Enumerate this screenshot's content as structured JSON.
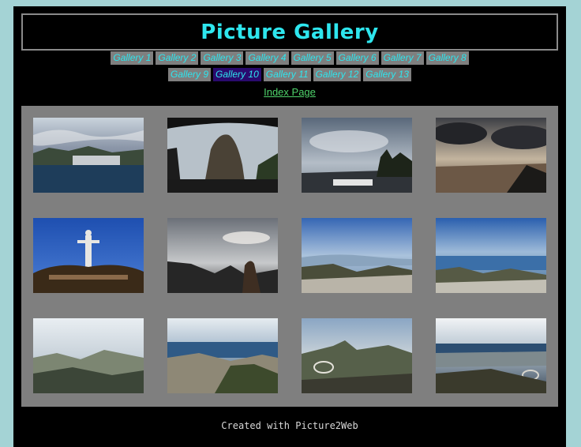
{
  "header": {
    "title": "Picture Gallery"
  },
  "nav": {
    "row1": [
      "Gallery 1",
      "Gallery 2",
      "Gallery 3",
      "Gallery 4",
      "Gallery 5",
      "Gallery 6",
      "Gallery 7",
      "Gallery 8"
    ],
    "row2": [
      "Gallery 9",
      "Gallery 10",
      "Gallery 11",
      "Gallery 12",
      "Gallery 13"
    ],
    "active": "Gallery 10",
    "index_label": "Index Page"
  },
  "footer": {
    "credit": "Created with Picture2Web"
  },
  "colors": {
    "page_bg": "#a4d3d5",
    "panel_bg": "#000000",
    "title": "#2ee6ee",
    "nav_bg": "#7f7f7f",
    "nav_active_bg": "#2a0a6e",
    "link": "#4fd36b",
    "grid_bg": "#7f7f7f"
  }
}
